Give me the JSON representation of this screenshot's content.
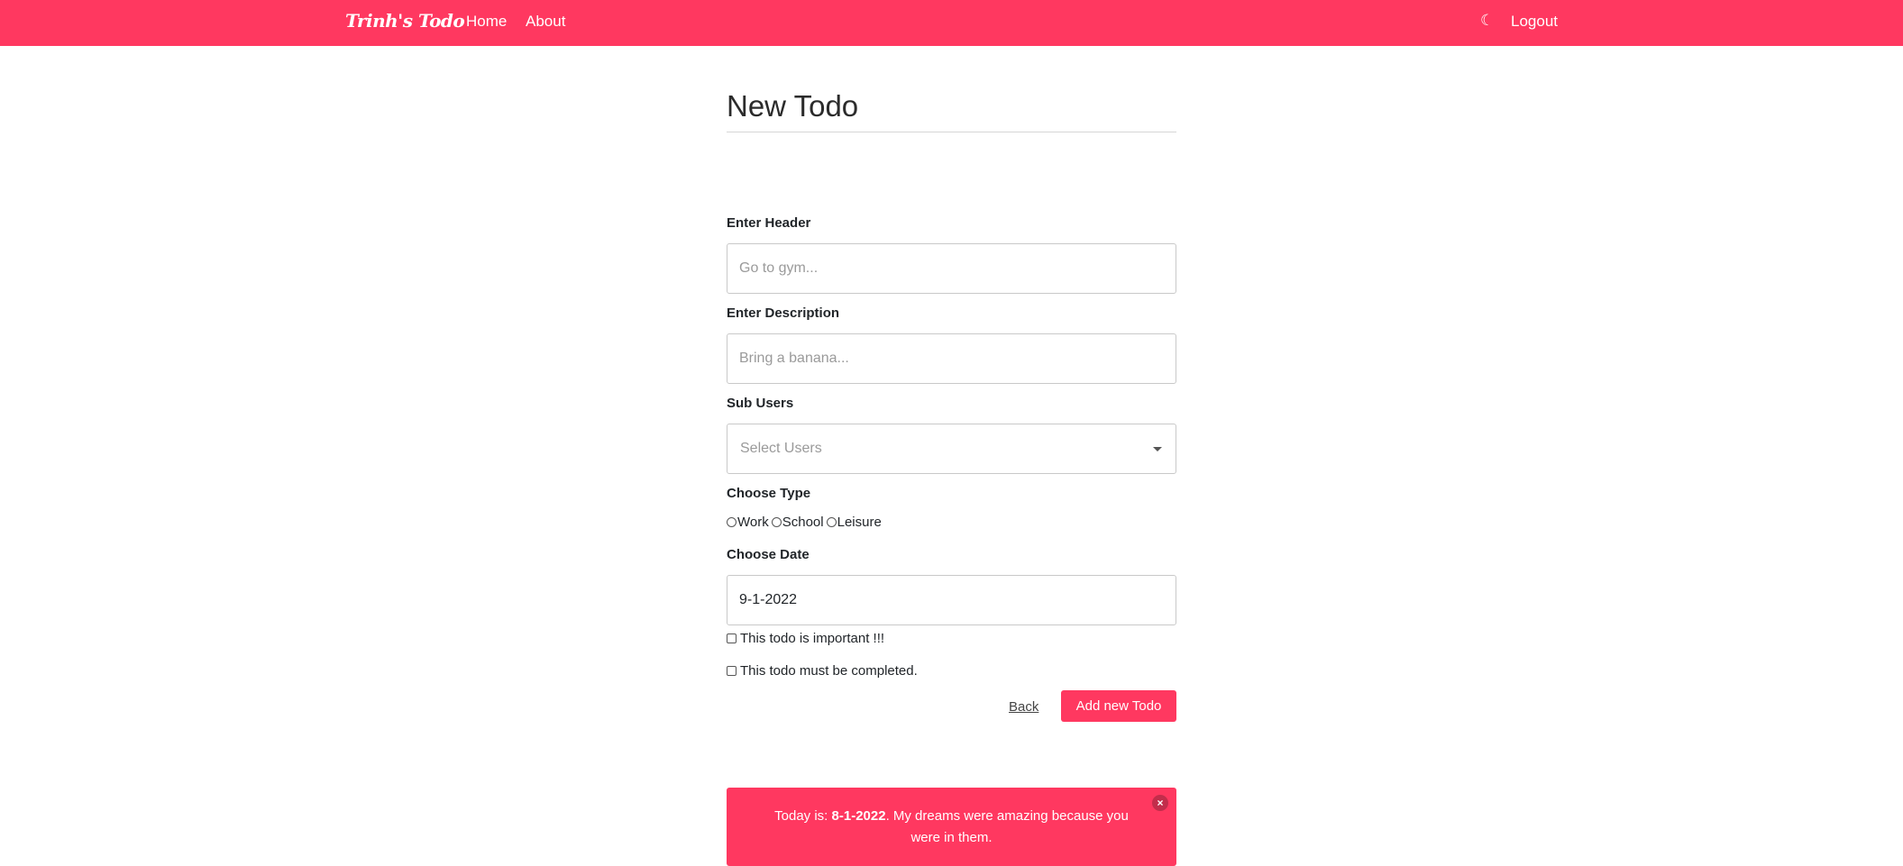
{
  "navbar": {
    "brand": "Trinh's Todo",
    "links": [
      "Home",
      "About"
    ],
    "theme_icon": "moon-icon",
    "logout": "Logout",
    "color": "#ff3860"
  },
  "form": {
    "title": "New Todo",
    "header": {
      "label": "Enter Header",
      "placeholder": "Go to gym..."
    },
    "description": {
      "label": "Enter Description",
      "placeholder": "Bring a banana..."
    },
    "sub_users": {
      "label": "Sub Users",
      "placeholder": "Select Users"
    },
    "type": {
      "label": "Choose Type",
      "options": [
        "Work",
        "School",
        "Leisure"
      ]
    },
    "date": {
      "label": "Choose Date",
      "value": "9-1-2022"
    },
    "important_label": "This todo is important !!!",
    "must_complete_label": "This todo must be completed.",
    "back_label": "Back",
    "submit_label": "Add new Todo"
  },
  "notification": {
    "prefix": "Today is: ",
    "date": "8-1-2022",
    "message": ". My dreams were amazing because you were in them.",
    "close_symbol": "×"
  }
}
